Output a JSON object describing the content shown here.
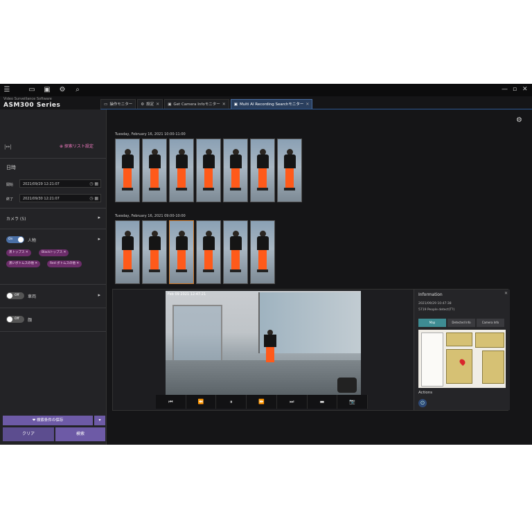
{
  "branding": {
    "line1": "Video Surveillance Software",
    "line2": "ASM300 Series"
  },
  "topbar": {
    "icons": [
      "hamburger-icon",
      "monitor-icon",
      "screen-icon",
      "gear-icon",
      "search-icon"
    ],
    "win": [
      "—",
      "▫",
      "✕"
    ]
  },
  "tabs": [
    {
      "label": "操作モニター",
      "icon": "monitor-icon"
    },
    {
      "label": "設定",
      "icon": "gear-icon"
    },
    {
      "label": "Get Camera Infoモニター",
      "icon": "screen-icon"
    },
    {
      "label": "Multi AI Recording Searchモニター",
      "icon": "screen-icon"
    }
  ],
  "left": {
    "add_list": "⊕ 探索リスト設定",
    "datetime_label": "日時",
    "start_label": "開始",
    "start_value": "2021/09/29   12:21:07",
    "end_label": "終了",
    "end_value": "2021/09/30   12:21:07",
    "camera_label": "カメラ (5)",
    "person_toggle": "On",
    "person_label": "人物",
    "chips": [
      "黒トップス ✕",
      "Blackトップス ✕",
      "黒いボトムスの他 ✕",
      "Red ボトムスの他 ✕"
    ],
    "vehicle_toggle": "Off",
    "vehicle_label": "車両",
    "face_toggle": "Off",
    "face_label": "顔",
    "save_label": "❤ 検索条件の保存",
    "clear_label": "クリア",
    "search_label": "検索"
  },
  "main": {
    "group1": "Tuesday, February 16, 2021 10:00-11:00",
    "group2": "Tuesday, February 16, 2021 09:00-10:00",
    "video_timestamp": "Feb 09 2021 12:47:21",
    "controls": [
      "⏮",
      "⏪",
      "⏸",
      "⏩",
      "⏭",
      "▬",
      "📷"
    ]
  },
  "info": {
    "title": "Information",
    "line1": "2021/09/29 10:47:38",
    "line2": "5719 People detect(T?)",
    "tabs": [
      "Map",
      "Detected Info",
      "Camera Info"
    ],
    "actions": "Actions"
  }
}
